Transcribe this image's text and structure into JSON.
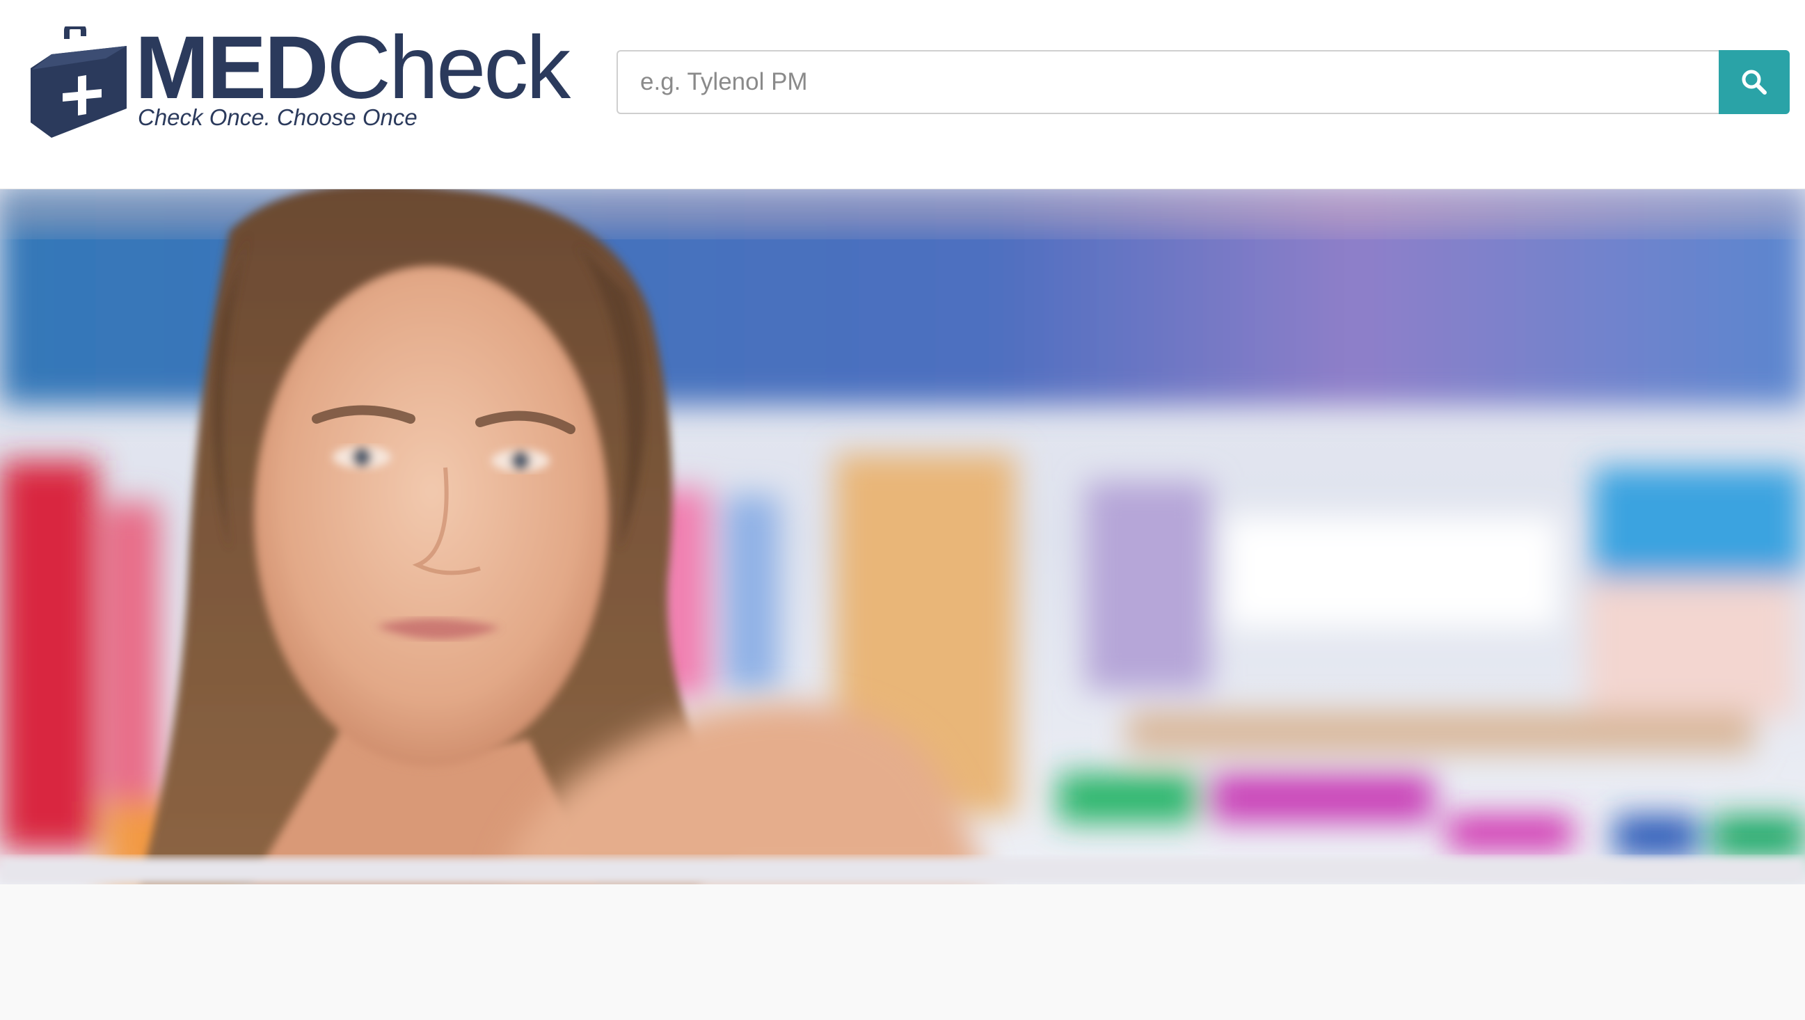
{
  "brand": {
    "name_bold": "MED",
    "name_light": "Check",
    "tagline": "Check Once. Choose Once",
    "color": "#2b3a5c"
  },
  "search": {
    "placeholder": "e.g. Tylenol PM",
    "value": "",
    "button_color": "#2aa3a7",
    "icon": "search-icon"
  },
  "hero": {
    "image_description_icon": "hero-photo"
  }
}
